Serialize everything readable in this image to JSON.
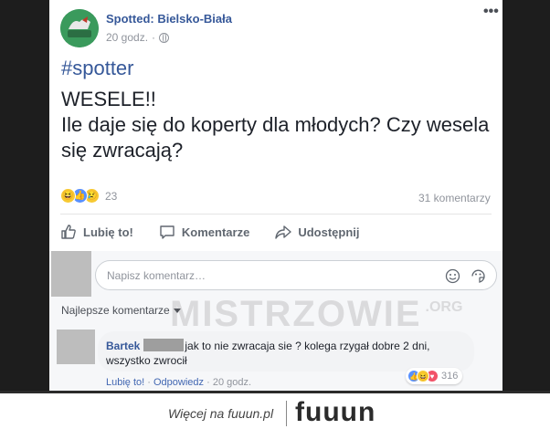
{
  "post": {
    "page_name": "Spotted: Bielsko-Biała",
    "time": "20 godz.",
    "separator": "·",
    "more_icon": "•••",
    "hashtag": "#spotter",
    "body_line1": "WESELE!!",
    "body_line2": "Ile daje się do koperty dla młodych? Czy wesela się zwracają?",
    "reactions": {
      "icons": [
        "haha-icon",
        "like-icon",
        "sad-icon"
      ],
      "count": "23"
    },
    "comment_count": "31 komentarzy",
    "actions": {
      "like": "Lubię to!",
      "comment": "Komentarze",
      "share": "Udostępnij"
    }
  },
  "comments": {
    "input_placeholder": "Napisz komentarz…",
    "filter_label": "Najlepsze komentarze",
    "top_comment": {
      "author": "Bartek",
      "text": "jak to nie zwracaja sie ? kolega rzygał dobre 2 dni, wszystko zwrocił",
      "reaction_count": "316",
      "like_link": "Lubię to!",
      "reply_link": "Odpowiedz",
      "time": "20 godz."
    }
  },
  "watermark": {
    "main": "MISTRZOWIE",
    "suffix": ".ORG"
  },
  "footer": {
    "text": "Więcej na fuuun.pl",
    "logo": "fuuun"
  },
  "colors": {
    "link": "#365899",
    "accent": "#4267b2",
    "footer_dark": "#2b2b2b"
  }
}
